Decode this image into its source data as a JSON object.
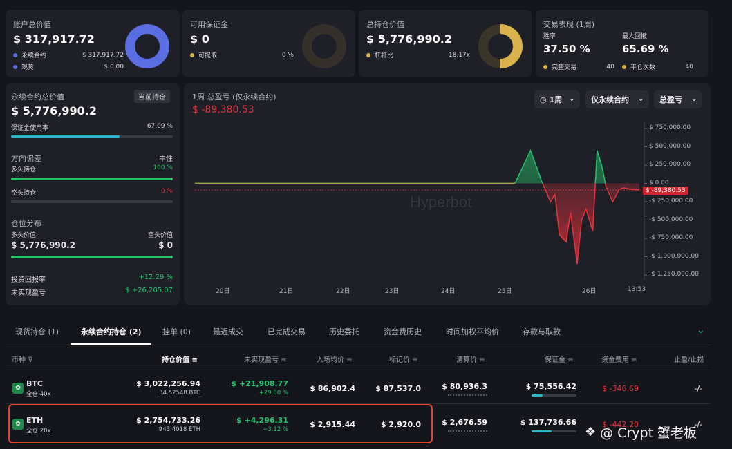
{
  "summary": {
    "account": {
      "title": "账户总价值",
      "value": "$ 317,917.72",
      "items": [
        {
          "label": "永续合约",
          "value": "$ 317,917.72",
          "color": "#5b6ee1"
        },
        {
          "label": "现货",
          "value": "$ 0.00",
          "color": "#5b6ee1"
        }
      ],
      "donut_fraction": 1.0,
      "donut_color": "#5b6ee1"
    },
    "margin": {
      "title": "可用保证金",
      "value": "$ 0",
      "items": [
        {
          "label": "可提取",
          "value": "0 %",
          "color": "#d9b24c"
        }
      ],
      "donut_fraction": 0.0
    },
    "holdings": {
      "title": "总持仓价值",
      "value": "$ 5,776,990.2",
      "items": [
        {
          "label": "杠杆比",
          "value": "18.17x",
          "color": "#d9b24c"
        }
      ],
      "donut_fraction": 0.5,
      "donut_color": "#d9b24c"
    },
    "performance": {
      "title": "交易表现 (1周)",
      "win_label": "胜率",
      "win_value": "37.50 %",
      "drawdown_label": "最大回撤",
      "drawdown_value": "65.69 %",
      "done_label": "完整交易",
      "done_value": "40",
      "flat_label": "平仓次数",
      "flat_value": "40"
    }
  },
  "perp_panel": {
    "title": "永续合约总价值",
    "badge": "当前持仓",
    "value": "$ 5,776,990.2",
    "margin_usage_label": "保证金使用率",
    "margin_usage_value": "67.09 %",
    "margin_usage_fraction": 0.6709,
    "direction_label": "方向偏差",
    "direction_value": "中性",
    "long_label": "多头持仓",
    "long_pct": "100 %",
    "long_fraction": 1.0,
    "short_label": "空头持仓",
    "short_pct": "0 %",
    "short_fraction": 0.0,
    "dist_label": "仓位分布",
    "long_value_label": "多头价值",
    "short_value_label": "空头价值",
    "long_value": "$ 5,776,990.2",
    "short_value": "$ 0",
    "roi_label": "投资回报率",
    "roi_value": "+12.29 %",
    "upnl_label": "未实现盈亏",
    "upnl_value": "$ +26,205.07"
  },
  "pnl_chart": {
    "title": "1周 总盈亏 (仅永续合约)",
    "value": "$ -89,380.53",
    "range_btn": "1周",
    "filter_btn": "仅永续合约",
    "metric_btn": "总盈亏",
    "watermark": "Hyperbot",
    "current_tag": "$ -89,380.53"
  },
  "chart_data": {
    "type": "area",
    "y_ticks": [
      "$ 750,000.00",
      "$ 500,000.00",
      "$ 250,000.00",
      "$ 0.00",
      "-$ 250,000.00",
      "-$ 500,000.00",
      "-$ 750,000.00",
      "-$ 1,000,000.00",
      "-$ 1,250,000.00"
    ],
    "x_ticks": [
      "20日",
      "21日",
      "22日",
      "23日",
      "24日",
      "25日",
      "26日",
      "13:53"
    ],
    "ylim": [
      -1250000,
      750000
    ],
    "x": [
      0,
      0.72,
      0.755,
      0.77,
      0.78,
      0.8,
      0.81,
      0.82,
      0.835,
      0.845,
      0.86,
      0.87,
      0.88,
      0.895,
      0.905,
      0.915,
      0.925,
      0.94,
      0.955,
      0.965,
      0.98,
      1.0
    ],
    "y": [
      0,
      0,
      450000,
      200000,
      30000,
      -250000,
      -150000,
      -700000,
      -800000,
      -400000,
      -1100000,
      -500000,
      -350000,
      -650000,
      450000,
      250000,
      -50000,
      -250000,
      -80000,
      -60000,
      -80000,
      -89380
    ],
    "last_value": -89380.53
  },
  "tabs": [
    {
      "label": "现货持仓 (1)",
      "active": false
    },
    {
      "label": "永续合约持仓 (2)",
      "active": true
    },
    {
      "label": "挂单 (0)",
      "active": false
    },
    {
      "label": "最近成交",
      "active": false
    },
    {
      "label": "已完成交易",
      "active": false
    },
    {
      "label": "历史委托",
      "active": false
    },
    {
      "label": "资金费历史",
      "active": false
    },
    {
      "label": "时间加权平均价",
      "active": false
    },
    {
      "label": "存款与取款",
      "active": false
    }
  ],
  "table": {
    "headers": {
      "coin": "币种",
      "position_value": "持仓价值",
      "upnl": "未实现盈亏",
      "entry": "入场均价",
      "mark": "标记价",
      "liq": "清算价",
      "margin": "保证金",
      "funding": "资金费用",
      "tpsl": "止盈/止损"
    },
    "rows": [
      {
        "coin": "BTC",
        "mode": "全仓 40x",
        "value": "$ 3,022,256.94",
        "size": "34.52548 BTC",
        "upnl": "$ +21,908.77",
        "upnl_pct": "+29.00 %",
        "entry": "$ 86,902.4",
        "mark": "$ 87,537.0",
        "liq": "$ 80,936.3",
        "margin": "$ 75,556.42",
        "margin_fraction": 0.25,
        "funding": "$ -346.69",
        "tpsl": "-/-"
      },
      {
        "coin": "ETH",
        "mode": "全仓 20x",
        "value": "$ 2,754,733.26",
        "size": "943.4018 ETH",
        "upnl": "$ +4,296.31",
        "upnl_pct": "+3.12 %",
        "entry": "$ 2,915.44",
        "mark": "$ 2,920.0",
        "liq": "$ 2,676.59",
        "margin": "$ 137,736.66",
        "margin_fraction": 0.45,
        "funding": "$ -442.20",
        "tpsl": "-/-"
      }
    ]
  },
  "watermark_footer": "@ Crypt 蟹老板"
}
